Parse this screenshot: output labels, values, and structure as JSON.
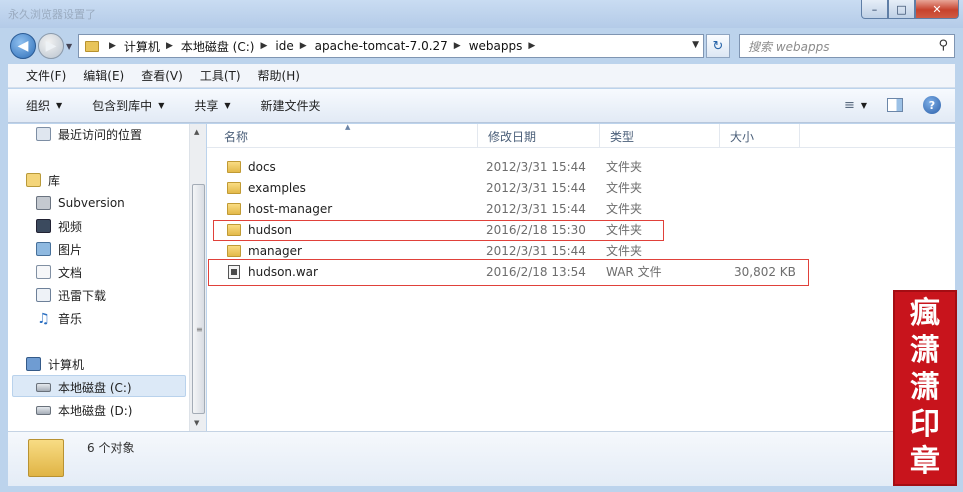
{
  "window": {
    "title": "永久浏览器设置了",
    "min_label": "–",
    "max_label": "□",
    "close_label": "✕"
  },
  "address": {
    "crumbs": [
      "计算机",
      "本地磁盘 (C:)",
      "ide",
      "apache-tomcat-7.0.27",
      "webapps"
    ]
  },
  "search": {
    "placeholder": "搜索 webapps"
  },
  "menu": [
    "文件(F)",
    "编辑(E)",
    "查看(V)",
    "工具(T)",
    "帮助(H)"
  ],
  "commands": {
    "organize": "组织",
    "include_in_library": "包含到库中",
    "share": "共享",
    "new_folder": "新建文件夹"
  },
  "nav": {
    "recent": "最近访问的位置",
    "library": "库",
    "library_items": [
      "Subversion",
      "视频",
      "图片",
      "文档",
      "迅雷下载",
      "音乐"
    ],
    "computer": "计算机",
    "drives": [
      "本地磁盘 (C:)",
      "本地磁盘 (D:)"
    ],
    "selected_drive": "本地磁盘 (C:)"
  },
  "columns": {
    "name": "名称",
    "modified": "修改日期",
    "type": "类型",
    "size": "大小"
  },
  "files": [
    {
      "name": "docs",
      "modified": "2012/3/31 15:44",
      "type": "文件夹",
      "size": "",
      "kind": "folder"
    },
    {
      "name": "examples",
      "modified": "2012/3/31 15:44",
      "type": "文件夹",
      "size": "",
      "kind": "folder"
    },
    {
      "name": "host-manager",
      "modified": "2012/3/31 15:44",
      "type": "文件夹",
      "size": "",
      "kind": "folder"
    },
    {
      "name": "hudson",
      "modified": "2016/2/18 15:30",
      "type": "文件夹",
      "size": "",
      "kind": "folder"
    },
    {
      "name": "manager",
      "modified": "2012/3/31 15:44",
      "type": "文件夹",
      "size": "",
      "kind": "folder"
    },
    {
      "name": "hudson.war",
      "modified": "2016/2/18 13:54",
      "type": "WAR 文件",
      "size": "30,802 KB",
      "kind": "file"
    }
  ],
  "status": {
    "count": "6 个对象"
  },
  "seal": {
    "text": "瘋潇潇印章"
  },
  "colors": {
    "accent": "#3a78c4",
    "highlight_border": "#e0413a",
    "seal_red": "#c8141c"
  }
}
